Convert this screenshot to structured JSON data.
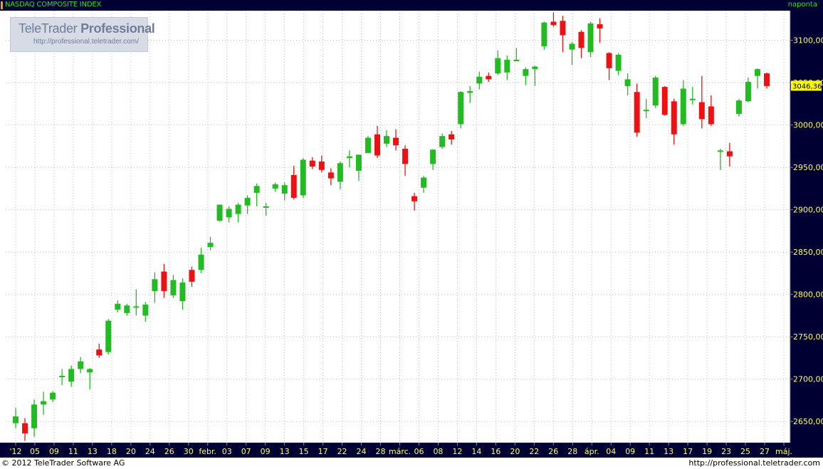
{
  "header": {
    "title": "NASDAQ COMPOSITE INDEX",
    "period": "naponta"
  },
  "watermark": {
    "brand_light": "TeleTrader",
    "brand_bold": "Professional",
    "url": "http://professional.teletrader.com/"
  },
  "footer": {
    "copyright": "© 2012 TeleTrader Software AG",
    "url": "http://professional.teletrader.com"
  },
  "colors": {
    "up": "#22bb22",
    "down": "#ee1111",
    "axis_bg": "#000033",
    "axis_text": "#ffff66",
    "last_badge": "#ffff00"
  },
  "chart_data": {
    "type": "candlestick",
    "title": "NASDAQ COMPOSITE INDEX",
    "ylim": [
      2625,
      3135
    ],
    "y_ticks": [
      "2650,00",
      "2700,00",
      "2750,00",
      "2800,00",
      "2850,00",
      "2900,00",
      "2950,00",
      "3000,00",
      "3050,00",
      "3100,00"
    ],
    "x_tick_labels": [
      "'12",
      "05",
      "09",
      "11",
      "13",
      "18",
      "20",
      "24",
      "26",
      "30",
      "febr.",
      "03",
      "07",
      "09",
      "13",
      "15",
      "17",
      "22",
      "24",
      "28",
      "márc.",
      "06",
      "08",
      "12",
      "14",
      "16",
      "20",
      "22",
      "26",
      "28",
      "ápr.",
      "04",
      "09",
      "11",
      "13",
      "17",
      "19",
      "23",
      "25",
      "27",
      "máj."
    ],
    "last_value": "3046,36",
    "candles": [
      {
        "o": 2648,
        "h": 2666,
        "l": 2642,
        "c": 2656
      },
      {
        "o": 2648,
        "h": 2654,
        "l": 2627,
        "c": 2636
      },
      {
        "o": 2642,
        "h": 2676,
        "l": 2632,
        "c": 2670
      },
      {
        "o": 2670,
        "h": 2685,
        "l": 2658,
        "c": 2674
      },
      {
        "o": 2676,
        "h": 2686,
        "l": 2673,
        "c": 2684
      },
      {
        "o": 2703,
        "h": 2712,
        "l": 2693,
        "c": 2704
      },
      {
        "o": 2697,
        "h": 2716,
        "l": 2691,
        "c": 2712
      },
      {
        "o": 2712,
        "h": 2726,
        "l": 2707,
        "c": 2721
      },
      {
        "o": 2708,
        "h": 2713,
        "l": 2688,
        "c": 2712
      },
      {
        "o": 2735,
        "h": 2742,
        "l": 2725,
        "c": 2728
      },
      {
        "o": 2732,
        "h": 2771,
        "l": 2729,
        "c": 2769
      },
      {
        "o": 2782,
        "h": 2793,
        "l": 2779,
        "c": 2789
      },
      {
        "o": 2778,
        "h": 2789,
        "l": 2775,
        "c": 2787
      },
      {
        "o": 2786,
        "h": 2806,
        "l": 2775,
        "c": 2786
      },
      {
        "o": 2775,
        "h": 2791,
        "l": 2768,
        "c": 2788
      },
      {
        "o": 2804,
        "h": 2826,
        "l": 2790,
        "c": 2818
      },
      {
        "o": 2827,
        "h": 2836,
        "l": 2796,
        "c": 2804
      },
      {
        "o": 2799,
        "h": 2823,
        "l": 2796,
        "c": 2817
      },
      {
        "o": 2792,
        "h": 2819,
        "l": 2782,
        "c": 2814
      },
      {
        "o": 2829,
        "h": 2833,
        "l": 2809,
        "c": 2815
      },
      {
        "o": 2829,
        "h": 2855,
        "l": 2825,
        "c": 2847
      },
      {
        "o": 2856,
        "h": 2868,
        "l": 2852,
        "c": 2861
      },
      {
        "o": 2887,
        "h": 2906,
        "l": 2886,
        "c": 2906
      },
      {
        "o": 2891,
        "h": 2904,
        "l": 2885,
        "c": 2901
      },
      {
        "o": 2895,
        "h": 2908,
        "l": 2885,
        "c": 2906
      },
      {
        "o": 2905,
        "h": 2917,
        "l": 2895,
        "c": 2914
      },
      {
        "o": 2920,
        "h": 2931,
        "l": 2904,
        "c": 2928
      },
      {
        "o": 2903,
        "h": 2908,
        "l": 2893,
        "c": 2904
      },
      {
        "o": 2925,
        "h": 2932,
        "l": 2921,
        "c": 2930
      },
      {
        "o": 2919,
        "h": 2932,
        "l": 2911,
        "c": 2929
      },
      {
        "o": 2941,
        "h": 2952,
        "l": 2912,
        "c": 2914
      },
      {
        "o": 2917,
        "h": 2961,
        "l": 2914,
        "c": 2959
      },
      {
        "o": 2958,
        "h": 2962,
        "l": 2948,
        "c": 2951
      },
      {
        "o": 2957,
        "h": 2964,
        "l": 2944,
        "c": 2947
      },
      {
        "o": 2944,
        "h": 2949,
        "l": 2929,
        "c": 2937
      },
      {
        "o": 2933,
        "h": 2957,
        "l": 2924,
        "c": 2955
      },
      {
        "o": 2961,
        "h": 2970,
        "l": 2950,
        "c": 2963
      },
      {
        "o": 2946,
        "h": 2965,
        "l": 2934,
        "c": 2965
      },
      {
        "o": 2967,
        "h": 2987,
        "l": 2967,
        "c": 2985
      },
      {
        "o": 2989,
        "h": 2999,
        "l": 2961,
        "c": 2964
      },
      {
        "o": 2978,
        "h": 2994,
        "l": 2974,
        "c": 2987
      },
      {
        "o": 2985,
        "h": 2995,
        "l": 2970,
        "c": 2976
      },
      {
        "o": 2972,
        "h": 2976,
        "l": 2940,
        "c": 2954
      },
      {
        "o": 2916,
        "h": 2920,
        "l": 2899,
        "c": 2910
      },
      {
        "o": 2926,
        "h": 2940,
        "l": 2920,
        "c": 2938
      },
      {
        "o": 2954,
        "h": 2971,
        "l": 2947,
        "c": 2971
      },
      {
        "o": 2974,
        "h": 2990,
        "l": 2972,
        "c": 2987
      },
      {
        "o": 2989,
        "h": 2993,
        "l": 2977,
        "c": 2983
      },
      {
        "o": 3001,
        "h": 3040,
        "l": 2996,
        "c": 3039
      },
      {
        "o": 3038,
        "h": 3046,
        "l": 3026,
        "c": 3040
      },
      {
        "o": 3049,
        "h": 3063,
        "l": 3042,
        "c": 3057
      },
      {
        "o": 3058,
        "h": 3062,
        "l": 3051,
        "c": 3054
      },
      {
        "o": 3061,
        "h": 3088,
        "l": 3059,
        "c": 3079
      },
      {
        "o": 3062,
        "h": 3082,
        "l": 3053,
        "c": 3077
      },
      {
        "o": 3077,
        "h": 3091,
        "l": 3076,
        "c": 3077
      },
      {
        "o": 3058,
        "h": 3068,
        "l": 3047,
        "c": 3066
      },
      {
        "o": 3066,
        "h": 3070,
        "l": 3046,
        "c": 3069
      },
      {
        "o": 3093,
        "h": 3122,
        "l": 3089,
        "c": 3121
      },
      {
        "o": 3122,
        "h": 3133,
        "l": 3116,
        "c": 3118
      },
      {
        "o": 3123,
        "h": 3129,
        "l": 3086,
        "c": 3106
      },
      {
        "o": 3089,
        "h": 3098,
        "l": 3071,
        "c": 3096
      },
      {
        "o": 3110,
        "h": 3112,
        "l": 3079,
        "c": 3091
      },
      {
        "o": 3086,
        "h": 3122,
        "l": 3080,
        "c": 3120
      },
      {
        "o": 3119,
        "h": 3126,
        "l": 3097,
        "c": 3114
      },
      {
        "o": 3085,
        "h": 3086,
        "l": 3053,
        "c": 3067
      },
      {
        "o": 3064,
        "h": 3085,
        "l": 3059,
        "c": 3083
      },
      {
        "o": 3046,
        "h": 3061,
        "l": 3035,
        "c": 3054
      },
      {
        "o": 3039,
        "h": 3049,
        "l": 2986,
        "c": 2991
      },
      {
        "o": 3018,
        "h": 3031,
        "l": 3008,
        "c": 3018
      },
      {
        "o": 3023,
        "h": 3058,
        "l": 3020,
        "c": 3056
      },
      {
        "o": 3045,
        "h": 3046,
        "l": 3011,
        "c": 3012
      },
      {
        "o": 3028,
        "h": 3031,
        "l": 2977,
        "c": 2989
      },
      {
        "o": 3001,
        "h": 3053,
        "l": 2999,
        "c": 3043
      },
      {
        "o": 3031,
        "h": 3045,
        "l": 3024,
        "c": 3031
      },
      {
        "o": 3027,
        "h": 3058,
        "l": 2996,
        "c": 3007
      },
      {
        "o": 3022,
        "h": 3035,
        "l": 2999,
        "c": 3001
      },
      {
        "o": 2970,
        "h": 2972,
        "l": 2947,
        "c": 2970
      },
      {
        "o": 2969,
        "h": 2979,
        "l": 2951,
        "c": 2963
      },
      {
        "o": 3013,
        "h": 3031,
        "l": 3010,
        "c": 3029
      },
      {
        "o": 3028,
        "h": 3056,
        "l": 3027,
        "c": 3051
      },
      {
        "o": 3058,
        "h": 3067,
        "l": 3043,
        "c": 3066
      },
      {
        "o": 3061,
        "h": 3062,
        "l": 3043,
        "c": 3046
      }
    ]
  }
}
